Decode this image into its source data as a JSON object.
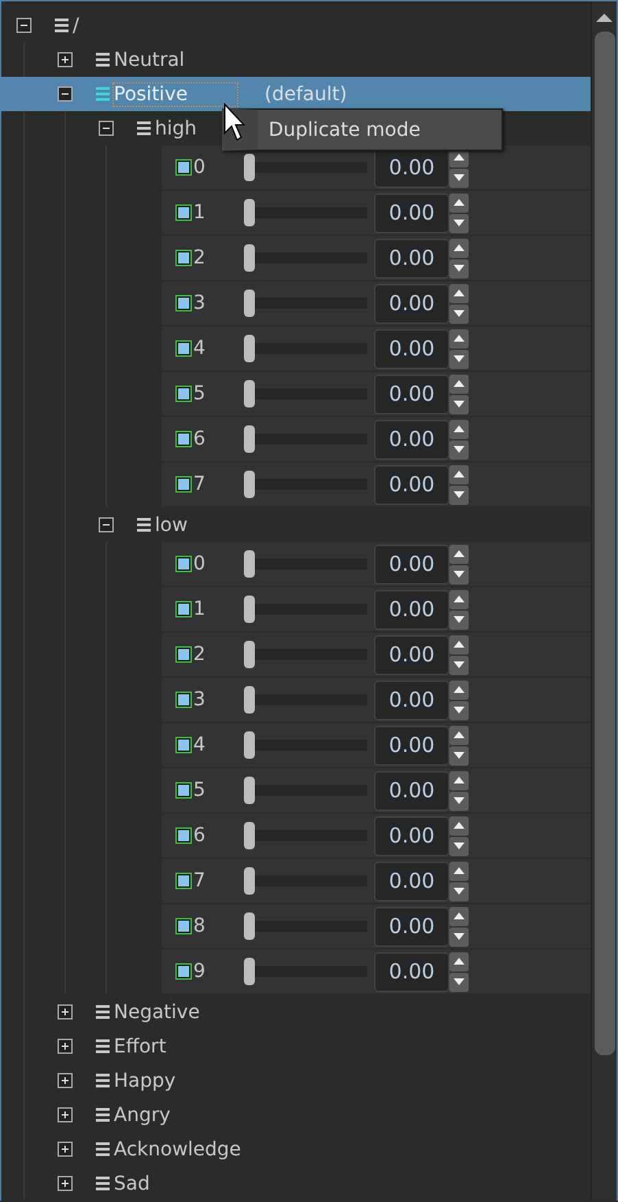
{
  "tree": [
    {
      "kind": "group",
      "label": "/",
      "expanded": true,
      "selected": false,
      "children": [
        {
          "kind": "group",
          "label": "Neutral",
          "expanded": false,
          "selected": false
        },
        {
          "kind": "group",
          "label": "Positive",
          "note": "(default)",
          "expanded": true,
          "selected": true,
          "children": [
            {
              "kind": "group",
              "label": "high",
              "expanded": true,
              "selected": false,
              "children": [
                {
                  "kind": "param",
                  "label": "0",
                  "level": 0,
                  "value": "0.00"
                },
                {
                  "kind": "param",
                  "label": "1",
                  "level": 0,
                  "value": "0.00"
                },
                {
                  "kind": "param",
                  "label": "2",
                  "level": 0,
                  "value": "0.00"
                },
                {
                  "kind": "param",
                  "label": "3",
                  "level": 0,
                  "value": "0.00"
                },
                {
                  "kind": "param",
                  "label": "4",
                  "level": 0,
                  "value": "0.00"
                },
                {
                  "kind": "param",
                  "label": "5",
                  "level": 0,
                  "value": "0.00"
                },
                {
                  "kind": "param",
                  "label": "6",
                  "level": 0,
                  "value": "0.00"
                },
                {
                  "kind": "param",
                  "label": "7",
                  "level": 0,
                  "value": "0.00"
                }
              ]
            },
            {
              "kind": "group",
              "label": "low",
              "expanded": true,
              "selected": false,
              "children": [
                {
                  "kind": "param",
                  "label": "0",
                  "level": 0,
                  "value": "0.00"
                },
                {
                  "kind": "param",
                  "label": "1",
                  "level": 0,
                  "value": "0.00"
                },
                {
                  "kind": "param",
                  "label": "2",
                  "level": 0,
                  "value": "0.00"
                },
                {
                  "kind": "param",
                  "label": "3",
                  "level": 0,
                  "value": "0.00"
                },
                {
                  "kind": "param",
                  "label": "4",
                  "level": 0,
                  "value": "0.00"
                },
                {
                  "kind": "param",
                  "label": "5",
                  "level": 0,
                  "value": "0.00"
                },
                {
                  "kind": "param",
                  "label": "6",
                  "level": 0,
                  "value": "0.00"
                },
                {
                  "kind": "param",
                  "label": "7",
                  "level": 0,
                  "value": "0.00"
                },
                {
                  "kind": "param",
                  "label": "8",
                  "level": 0,
                  "value": "0.00"
                },
                {
                  "kind": "param",
                  "label": "9",
                  "level": 0,
                  "value": "0.00"
                }
              ]
            }
          ]
        },
        {
          "kind": "group",
          "label": "Negative",
          "expanded": false,
          "selected": false
        },
        {
          "kind": "group",
          "label": "Effort",
          "expanded": false,
          "selected": false
        },
        {
          "kind": "group",
          "label": "Happy",
          "expanded": false,
          "selected": false
        },
        {
          "kind": "group",
          "label": "Angry",
          "expanded": false,
          "selected": false
        },
        {
          "kind": "group",
          "label": "Acknowledge",
          "expanded": false,
          "selected": false
        },
        {
          "kind": "group",
          "label": "Sad",
          "expanded": false,
          "selected": false
        }
      ]
    }
  ],
  "context_menu": {
    "items": [
      "Duplicate mode"
    ]
  }
}
